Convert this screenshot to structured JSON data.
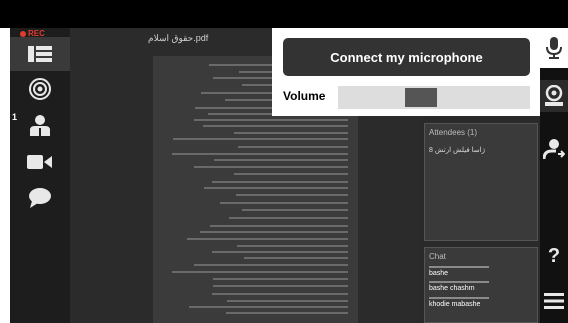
{
  "rec_label": "REC",
  "attendee_badge_count": "1",
  "document": {
    "title": "حقوق اسلام.pdf"
  },
  "attendees": {
    "title": "Attendees (1)",
    "items": [
      "ژاسا فیلش ارتش 8"
    ]
  },
  "chat": {
    "title": "Chat",
    "messages": [
      {
        "name": "bashe"
      },
      {
        "name": "bashe chashm"
      },
      {
        "name": "khodie mabashe"
      }
    ]
  },
  "audio": {
    "connect_label": "Connect my microphone",
    "volume_label": "Volume",
    "volume_level": 0.42
  },
  "right_help_label": "?",
  "colors": {
    "rec": "#e23b2c",
    "button": "#333333",
    "toolbar": "#1d1d1d"
  }
}
